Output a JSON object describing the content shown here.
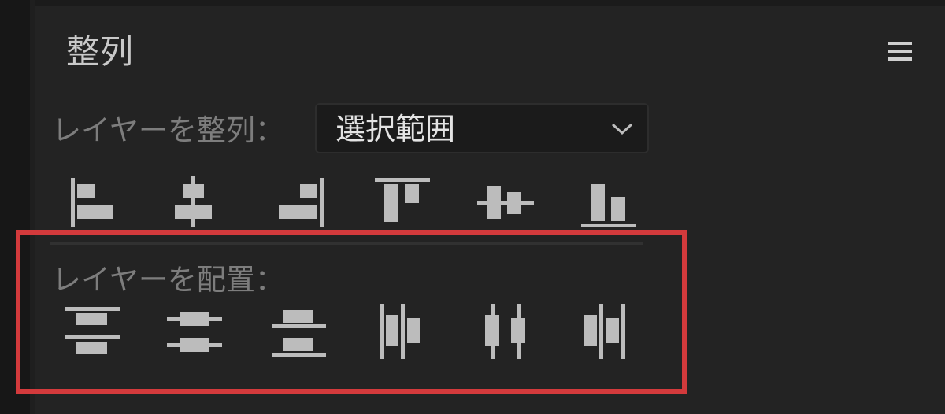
{
  "panel": {
    "title": "整列",
    "menu_icon": "hamburger-menu-icon"
  },
  "align_layers": {
    "label": "レイヤーを整列：",
    "dropdown": {
      "selected": "選択範囲",
      "icon": "chevron-down-icon"
    },
    "buttons": [
      "align-left-edges-icon",
      "align-horizontal-centers-icon",
      "align-right-edges-icon",
      "align-top-edges-icon",
      "align-vertical-centers-icon",
      "align-bottom-edges-icon"
    ]
  },
  "distribute_layers": {
    "label": "レイヤーを配置：",
    "buttons": [
      "distribute-top-edges-icon",
      "distribute-vertical-centers-icon",
      "distribute-bottom-edges-icon",
      "distribute-left-edges-icon",
      "distribute-horizontal-centers-icon",
      "distribute-right-edges-icon"
    ]
  },
  "colors": {
    "panel_background": "#232323",
    "icon_gray": "#bcbcbc",
    "label_gray": "#7d7d7d",
    "highlight_red": "#d33a3c"
  }
}
